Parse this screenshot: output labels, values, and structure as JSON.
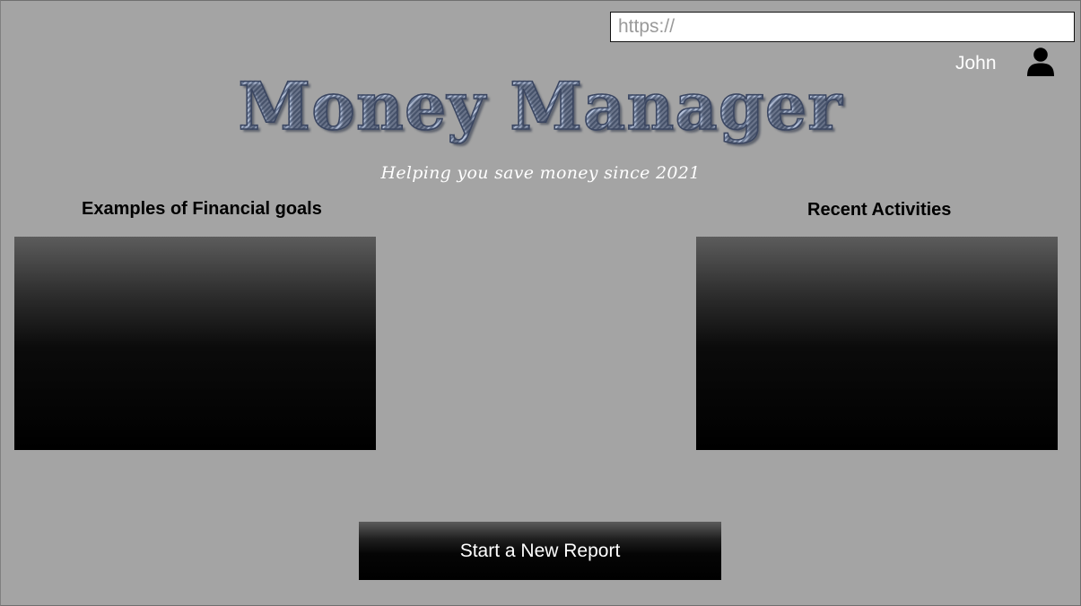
{
  "header": {
    "url_placeholder": "https://",
    "user_name": "John"
  },
  "branding": {
    "title": "Money Manager",
    "tagline": "Helping you save money since 2021"
  },
  "sections": {
    "left_heading": "Examples of Financial goals",
    "right_heading": "Recent Activities"
  },
  "actions": {
    "new_report_label": "Start a New Report"
  },
  "icons": {
    "user": "user-icon"
  },
  "colors": {
    "background": "#a4a4a4",
    "panel_top": "#5c5c5c",
    "panel_bottom": "#000000",
    "text_light": "#ffffff"
  }
}
